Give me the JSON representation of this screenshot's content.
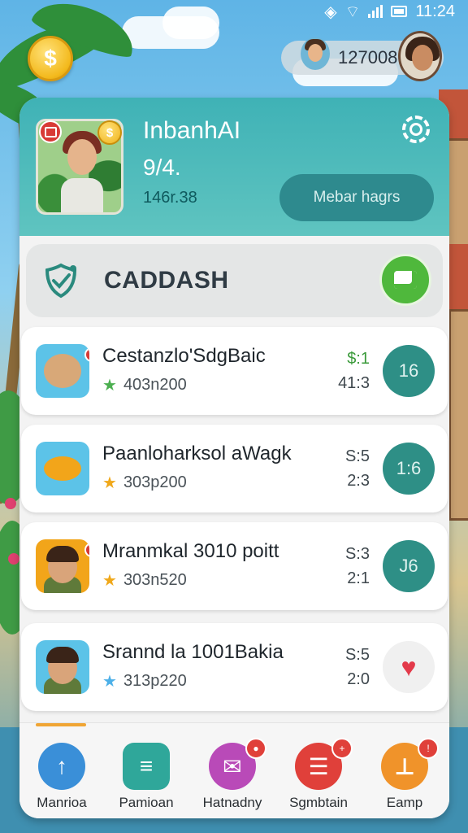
{
  "status_bar": {
    "time": "11:24"
  },
  "header": {
    "coin_icon": "coin-icon",
    "currency_value": "127008"
  },
  "profile": {
    "name": "InbanhAI",
    "level": "9/4.",
    "points": "146r.38",
    "member_button_label": "Mebar hagrs",
    "coin_badge_symbol": "$"
  },
  "cash": {
    "title": "CADDASH"
  },
  "entries": [
    {
      "title": "Cestanzlo'SdgBaic",
      "sub": "403n200",
      "star_color": "#4caf50",
      "v1": "$:1",
      "v2": "41:3",
      "v1_color": "#3a9a3a",
      "action": "16"
    },
    {
      "title": "Paanloharksol aWagk",
      "sub": "303p200",
      "star_color": "#f0a81a",
      "v1": "S:5",
      "v2": "2:3",
      "v1_color": "#3f484e",
      "action": "1:6"
    },
    {
      "title": "Mranmkal 3010 poitt",
      "sub": "303n520",
      "star_color": "#f0a81a",
      "v1": "S:3",
      "v2": "2:1",
      "v1_color": "#3f484e",
      "action": "J6"
    },
    {
      "title": "Srannd la 1001Bakia",
      "sub": "313p220",
      "star_color": "#4db0e8",
      "v1": "S:5",
      "v2": "2:0",
      "v1_color": "#3f484e",
      "action": "♥"
    }
  ],
  "nav": [
    {
      "label": "Manrioa",
      "icon": "arrow-up-icon",
      "color": "#3a8fd8"
    },
    {
      "label": "Pamioan",
      "icon": "chat-icon",
      "color": "#2fa79a"
    },
    {
      "label": "Hatnadny",
      "icon": "message-icon",
      "color": "#b94ab8"
    },
    {
      "label": "Sgmbtain",
      "icon": "list-icon",
      "color": "#e0403a"
    },
    {
      "label": "Eamp",
      "icon": "thumb-icon",
      "color": "#f0932a"
    }
  ]
}
